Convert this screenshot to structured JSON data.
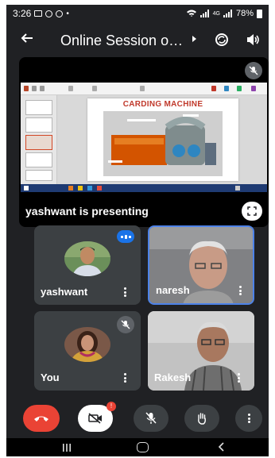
{
  "status_bar": {
    "time": "3:26",
    "network": "4G",
    "battery": "78%"
  },
  "header": {
    "title": "Online Session o…",
    "back_icon": "arrow-left-icon",
    "camera_switch_icon": "camera-switch-icon",
    "audio_icon": "speaker-icon"
  },
  "presentation": {
    "label": "yashwant is presenting",
    "slide_title": "CARDING MACHINE",
    "mic_state": "muted"
  },
  "participants": [
    {
      "name": "yashwant",
      "speaking": true,
      "muted": false
    },
    {
      "name": "naresh",
      "speaking": false,
      "muted": false,
      "active_speaker": true
    },
    {
      "name": "You",
      "speaking": false,
      "muted": true
    },
    {
      "name": "Rakesh",
      "speaking": false,
      "muted": false
    }
  ],
  "controls": {
    "end_call_icon": "phone-hangup-icon",
    "camera_off_icon": "camera-off-icon",
    "camera_alert_badge": "!",
    "mic_off_icon": "mic-off-icon",
    "raise_hand_icon": "raise-hand-icon",
    "more_icon": "more-vert-icon"
  },
  "colors": {
    "background": "#202124",
    "tile": "#3c4043",
    "end_call": "#ea4335",
    "accent": "#1a73e8"
  }
}
